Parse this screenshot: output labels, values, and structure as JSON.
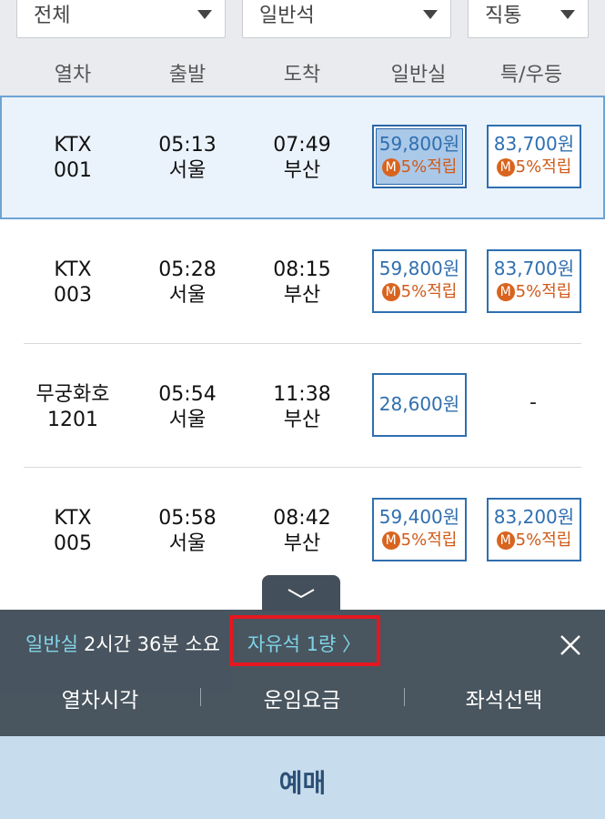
{
  "filters": {
    "train_type": "전체",
    "seat_class": "일반석",
    "route": "직통"
  },
  "columns": [
    "열차",
    "출발",
    "도착",
    "일반실",
    "특/우등"
  ],
  "trains": [
    {
      "name": "KTX",
      "number": "001",
      "dep_time": "05:13",
      "dep_station": "서울",
      "arr_time": "07:49",
      "arr_station": "부산",
      "general_price": "59,800원",
      "general_mileage": "5%적립",
      "special_price": "83,700원",
      "special_mileage": "5%적립",
      "special_available": true,
      "selected": true
    },
    {
      "name": "KTX",
      "number": "003",
      "dep_time": "05:28",
      "dep_station": "서울",
      "arr_time": "08:15",
      "arr_station": "부산",
      "general_price": "59,800원",
      "general_mileage": "5%적립",
      "special_price": "83,700원",
      "special_mileage": "5%적립",
      "special_available": true,
      "selected": false
    },
    {
      "name": "무궁화호",
      "number": "1201",
      "dep_time": "05:54",
      "dep_station": "서울",
      "arr_time": "11:38",
      "arr_station": "부산",
      "general_price": "28,600원",
      "general_mileage": "",
      "special_price": "-",
      "special_mileage": "",
      "special_available": false,
      "selected": false
    },
    {
      "name": "KTX",
      "number": "005",
      "dep_time": "05:58",
      "dep_station": "서울",
      "arr_time": "08:42",
      "arr_station": "부산",
      "general_price": "59,400원",
      "general_mileage": "5%적립",
      "special_price": "83,200원",
      "special_mileage": "5%적립",
      "special_available": true,
      "selected": false
    }
  ],
  "mileage_badge": "M",
  "panel": {
    "seat_class": "일반실",
    "duration": "2시간 36분 소요",
    "free_seat": "자유석 1량 〉",
    "actions": [
      "열차시각",
      "운임요금",
      "좌석선택"
    ]
  },
  "book_button": "예매",
  "colors": {
    "accent_blue": "#2f6fb0",
    "mileage_orange": "#d9641f",
    "panel_bg": "#434f5a",
    "highlight_red": "#e5171f",
    "book_bg": "#c7dcec"
  }
}
